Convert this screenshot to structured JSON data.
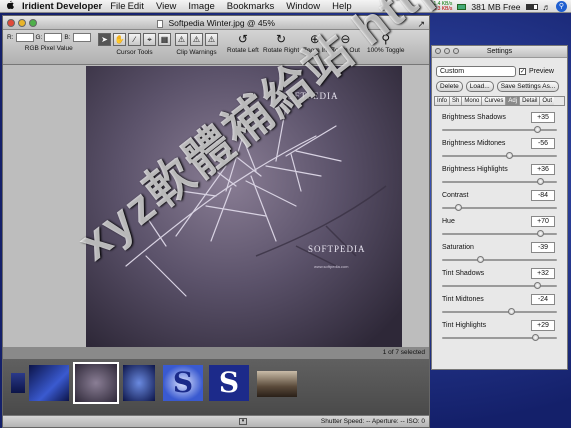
{
  "menubar": {
    "app_name": "Iridient Developer",
    "items": [
      "File",
      "Edit",
      "View",
      "Image",
      "Bookmarks",
      "Window",
      "Help"
    ],
    "net_up": "1.4 KB/s",
    "net_down": "4.3 KB/s",
    "memory": "381 MB Free"
  },
  "window": {
    "title": "Softpedia Winter.jpg @ 45%",
    "rgb_labels": [
      "R:",
      "G:",
      "B:"
    ],
    "toolbar": {
      "rgb_pixel_value": "RGB Pixel Value",
      "cursor_tools": "Cursor Tools",
      "clip_warnings": "Clip Warnings",
      "rotate_left": "Rotate Left",
      "rotate_right": "Rotate Right",
      "zoom_in": "Zoom In",
      "zoom_out": "Zoom Out",
      "toggle_100": "100% Toggle"
    },
    "watermark_top": "SOFTPEDIA",
    "watermark_bottom": "SOFTPEDIA",
    "watermark_url": "www.softpedia.com",
    "selection_count": "1 of 7 selected",
    "status": {
      "shutter": "Shutter Speed: --",
      "aperture": "Aperture: --",
      "iso": "ISO: 0"
    },
    "overlay_text": "xyz軟體補給站 http://131.to"
  },
  "settings": {
    "title": "Settings",
    "preset": "Custom",
    "preview_label": "Preview",
    "delete_label": "Delete",
    "load_label": "Load...",
    "save_label": "Save Settings As...",
    "tabs": [
      "Info",
      "Sh",
      "Mono",
      "Curves",
      "Adj",
      "Detail",
      "Out"
    ],
    "params": [
      {
        "label": "Brightness Shadows",
        "value": "+35",
        "pos": 0.84
      },
      {
        "label": "Brightness Midtones",
        "value": "-56",
        "pos": 0.58
      },
      {
        "label": "Brightness Highlights",
        "value": "+36",
        "pos": 0.86
      },
      {
        "label": "Contrast",
        "value": "-84",
        "pos": 0.12
      },
      {
        "label": "Hue",
        "value": "+70",
        "pos": 0.86
      },
      {
        "label": "Saturation",
        "value": "-39",
        "pos": 0.32
      },
      {
        "label": "Tint Shadows",
        "value": "+32",
        "pos": 0.84
      },
      {
        "label": "Tint Midtones",
        "value": "-24",
        "pos": 0.6
      },
      {
        "label": "Tint Highlights",
        "value": "+29",
        "pos": 0.82
      }
    ]
  }
}
